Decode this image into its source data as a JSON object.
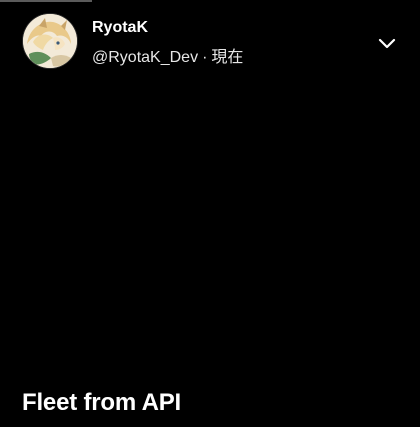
{
  "progress": {
    "fraction": 0.22,
    "color": "#5b5b5b"
  },
  "author": {
    "name": "RyotaK",
    "handle": "@RyotaK_Dev",
    "separator": "·",
    "time": "現在",
    "avatar_icon": "avatar-illustration"
  },
  "menu": {
    "icon": "chevron-down-icon"
  },
  "fleet": {
    "text": "Fleet from API"
  },
  "colors": {
    "background": "#000000",
    "text": "#ffffff"
  }
}
